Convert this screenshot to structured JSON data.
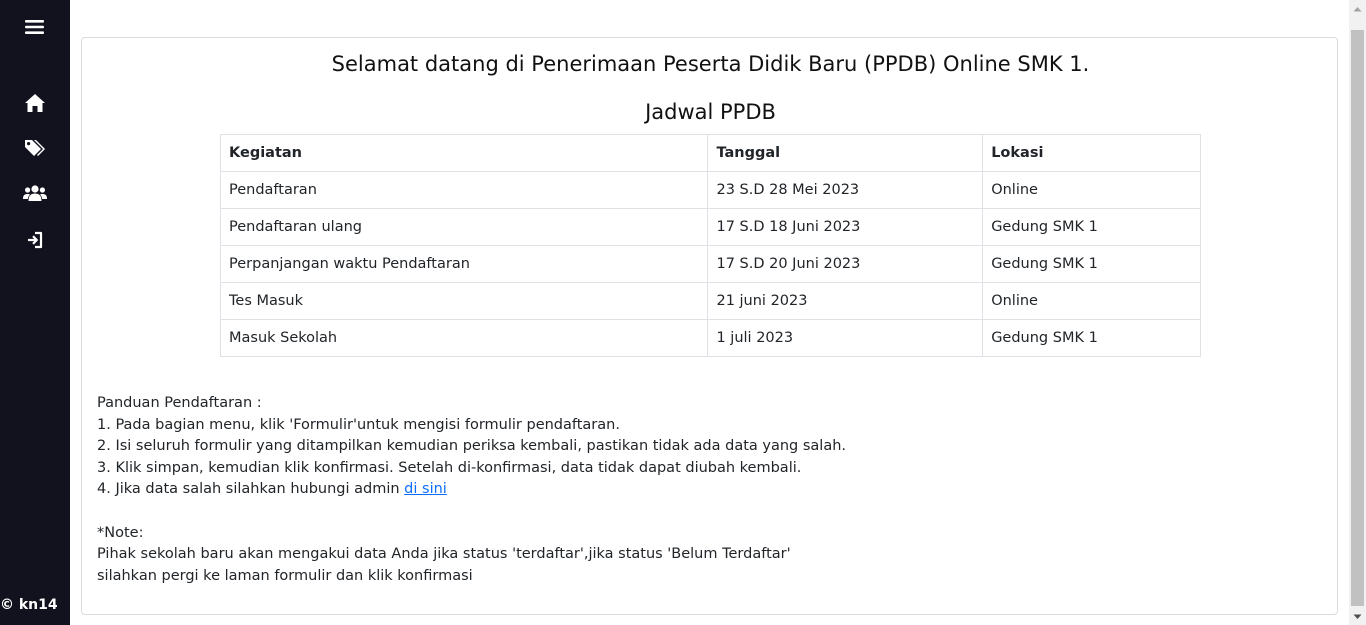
{
  "sidebar": {
    "icons": [
      "menu-icon",
      "home-icon",
      "tags-icon",
      "users-icon",
      "logout-icon"
    ],
    "copyright": "© kn14",
    "background": "#12121f"
  },
  "main": {
    "welcome": "Selamat datang di Penerimaan Peserta Didik Baru (PPDB) Online SMK 1.",
    "schedule_title": "Jadwal PPDB",
    "table": {
      "headers": [
        "Kegiatan",
        "Tanggal",
        "Lokasi"
      ],
      "rows": [
        [
          "Pendaftaran",
          "23 S.D 28 Mei 2023",
          "Online"
        ],
        [
          "Pendaftaran ulang",
          "17 S.D 18 Juni 2023",
          "Gedung SMK 1"
        ],
        [
          "Perpanjangan waktu Pendaftaran",
          "17 S.D 20 Juni 2023",
          "Gedung SMK 1"
        ],
        [
          "Tes Masuk",
          "21 juni 2023",
          "Online"
        ],
        [
          "Masuk Sekolah",
          "1 juli 2023",
          "Gedung SMK 1"
        ]
      ]
    },
    "guide": {
      "heading": "Panduan Pendaftaran :",
      "step1": "1. Pada bagian menu, klik 'Formulir'untuk mengisi formulir pendaftaran.",
      "step2": "2. Isi seluruh formulir yang ditampilkan kemudian periksa kembali, pastikan tidak ada data yang salah.",
      "step3": "3. Klik simpan, kemudian klik konfirmasi. Setelah di-konfirmasi, data tidak dapat diubah kembali.",
      "step4": "4. Jika data salah silahkan hubungi admin ",
      "step4_link": "di sini",
      "note_heading": "*Note:",
      "note_line1": "Pihak sekolah baru akan mengakui data Anda jika status 'terdaftar',jika status 'Belum Terdaftar'",
      "note_line2": "silahkan pergi ke laman formulir dan klik konfirmasi"
    },
    "link_color": "#0d6efd"
  }
}
